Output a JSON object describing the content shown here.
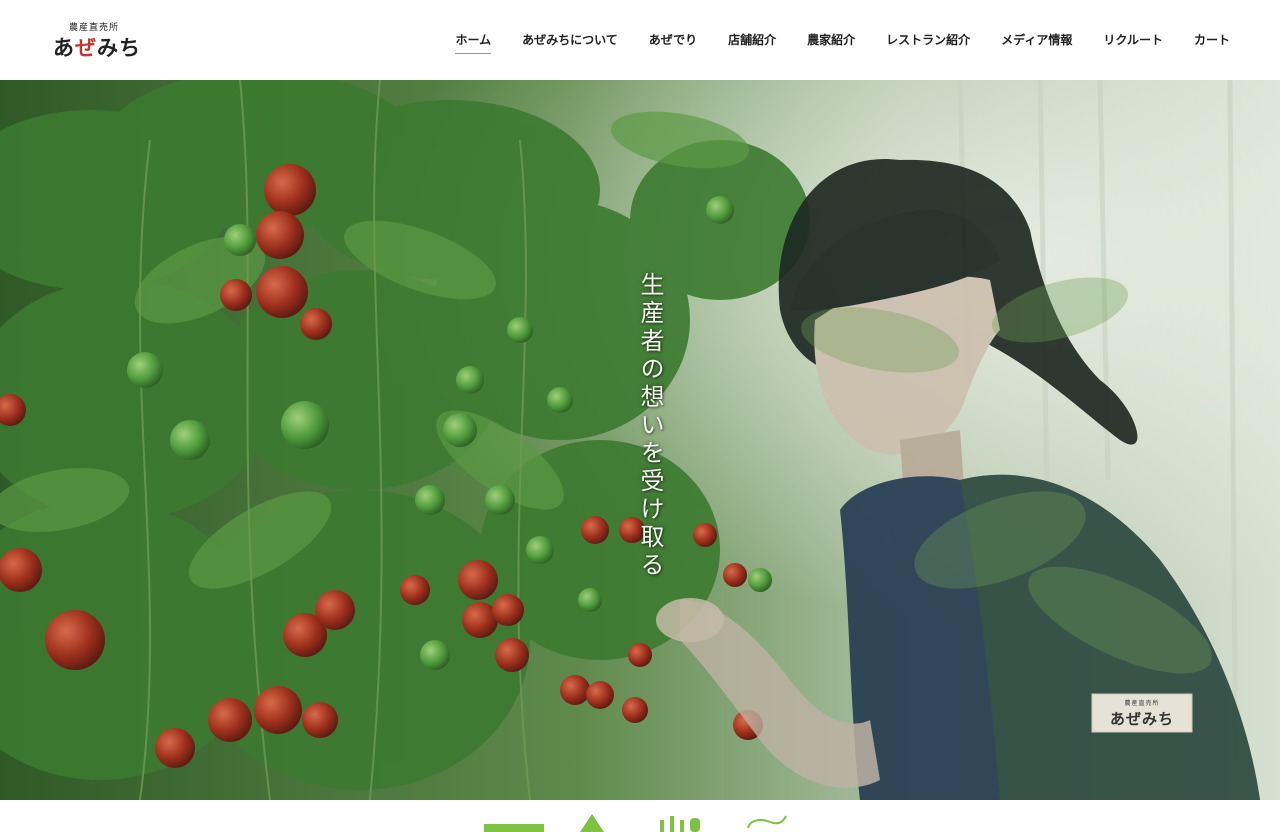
{
  "site": {
    "logo_sub": "農産直売所",
    "logo_main_a": "あ",
    "logo_main_b": "ぜ",
    "logo_main_c": "みち"
  },
  "nav": {
    "items": [
      {
        "label": "ホーム",
        "active": true
      },
      {
        "label": "あぜみちについて"
      },
      {
        "label": "あぜでり"
      },
      {
        "label": "店舗紹介"
      },
      {
        "label": "農家紹介"
      },
      {
        "label": "レストラン紹介"
      },
      {
        "label": "メディア情報"
      },
      {
        "label": "リクルート"
      },
      {
        "label": "カート"
      }
    ]
  },
  "hero": {
    "tagline": "生産者の想いを受け取る",
    "apron_logo_sub": "農産直売所",
    "apron_logo_main": "あぜみち"
  },
  "colors": {
    "accent_red": "#c8342c",
    "brand_green": "#7dc243",
    "foliage_green": "#3f7a34"
  }
}
